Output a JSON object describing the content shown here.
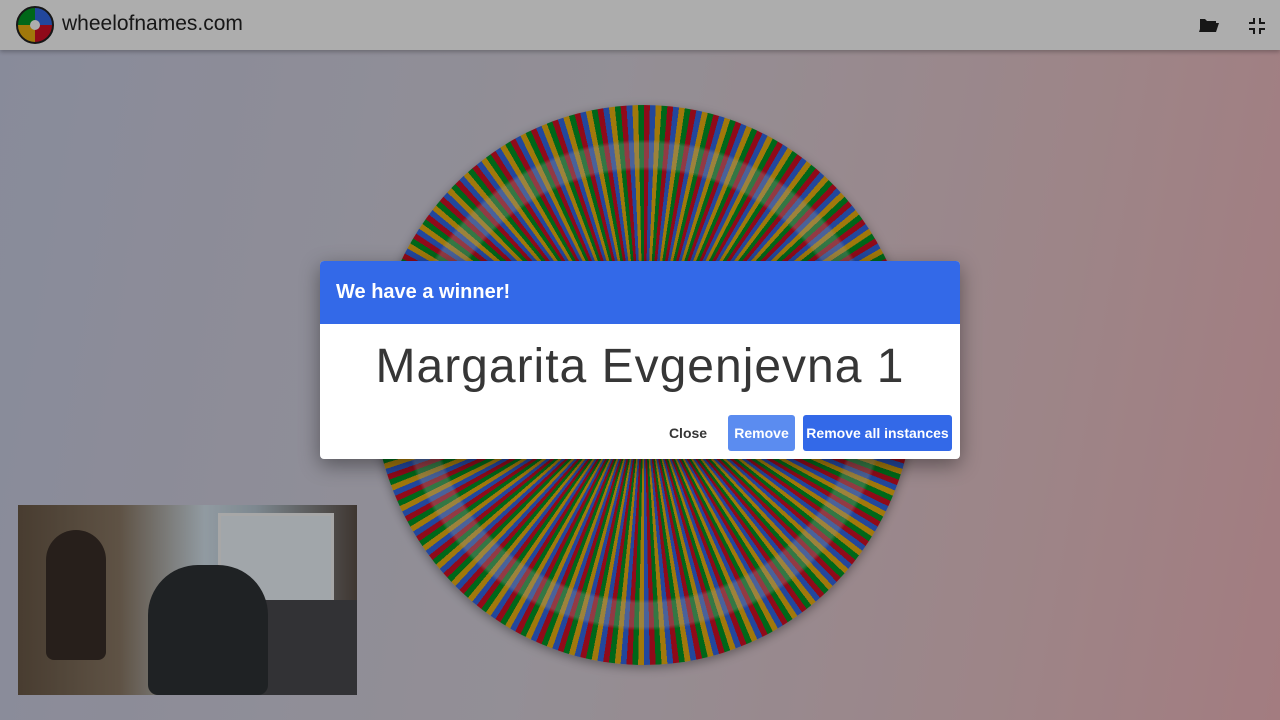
{
  "header": {
    "site_title": "wheelofnames.com",
    "open_icon": "folder-open-icon",
    "exit_fullscreen_icon": "exit-fullscreen-icon"
  },
  "wheel": {
    "colors": [
      "#d50f25",
      "#3369e8",
      "#eeb211",
      "#009925"
    ]
  },
  "dialog": {
    "title": "We have a winner!",
    "winner": "Margarita Evgenjevna 1",
    "close_label": "Close",
    "remove_label": "Remove",
    "remove_all_label": "Remove all instances"
  },
  "colors": {
    "accent": "#3369e8"
  }
}
